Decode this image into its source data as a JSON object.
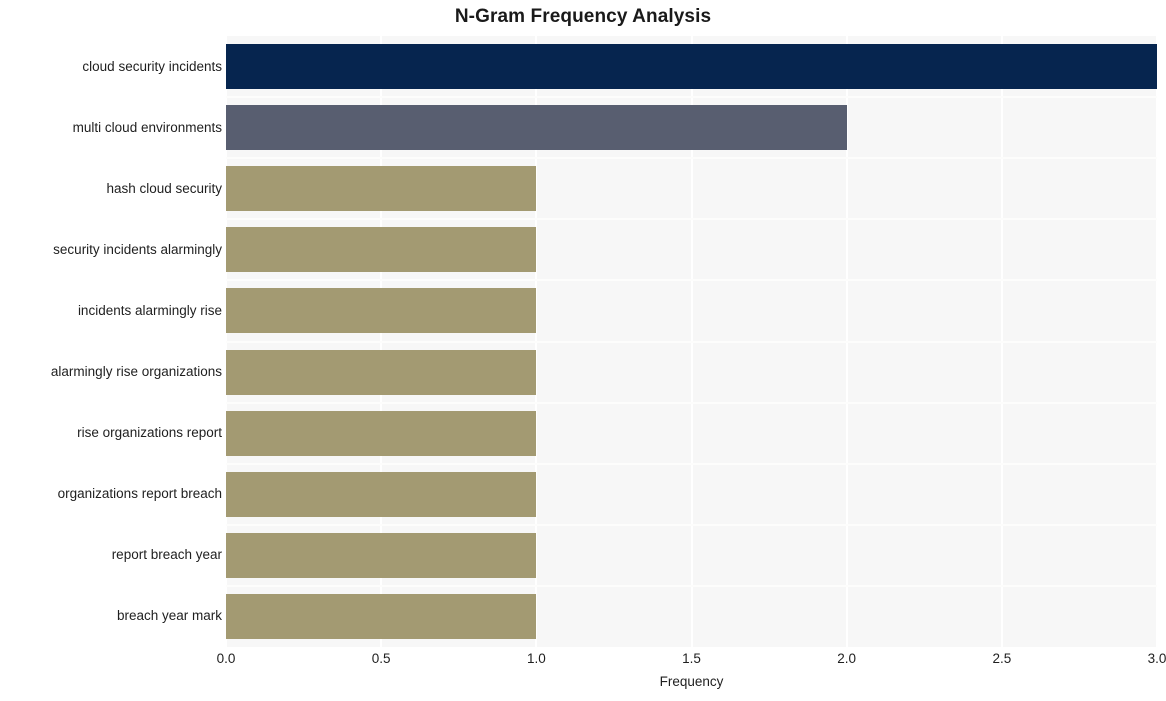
{
  "chart_data": {
    "type": "bar",
    "orientation": "horizontal",
    "title": "N-Gram Frequency Analysis",
    "xlabel": "Frequency",
    "ylabel": "",
    "categories": [
      "cloud security incidents",
      "multi cloud environments",
      "hash cloud security",
      "security incidents alarmingly",
      "incidents alarmingly rise",
      "alarmingly rise organizations",
      "rise organizations report",
      "organizations report breach",
      "report breach year",
      "breach year mark"
    ],
    "values": [
      3,
      2,
      1,
      1,
      1,
      1,
      1,
      1,
      1,
      1
    ],
    "bar_colors": [
      "#06254f",
      "#585e70",
      "#a39a72",
      "#a39a72",
      "#a39a72",
      "#a39a72",
      "#a39a72",
      "#a39a72",
      "#a39a72",
      "#a39a72"
    ],
    "xlim": [
      0,
      3.0
    ],
    "xticks": [
      0.0,
      0.5,
      1.0,
      1.5,
      2.0,
      2.5,
      3.0
    ],
    "xtick_labels": [
      "0.0",
      "0.5",
      "1.0",
      "1.5",
      "2.0",
      "2.5",
      "3.0"
    ],
    "grid": true,
    "grid_color": "#ffffff",
    "plot_background": "#f7f7f7",
    "figure_background": "#ffffff",
    "legend": null
  }
}
